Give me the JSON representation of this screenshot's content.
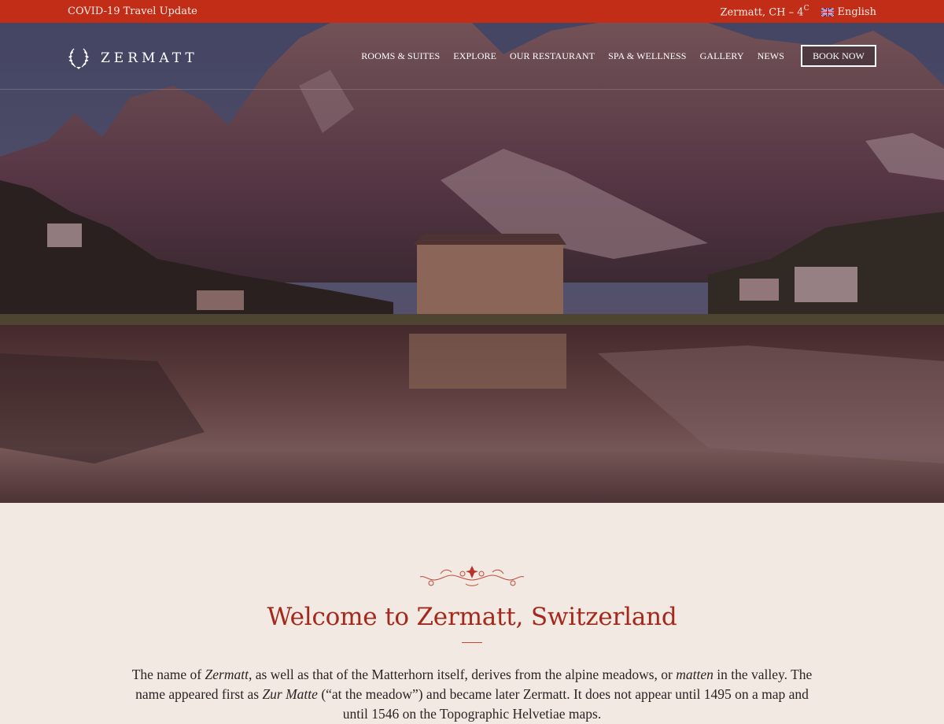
{
  "topbar": {
    "notice_link": "COVID-19 Travel Update",
    "weather": "Zermatt, CH – 4",
    "weather_unit": "C",
    "language": "English",
    "language_flag": "uk-flag-icon"
  },
  "brand": {
    "name": "ZERMATT",
    "logo_icon": "laurel-wreath-icon"
  },
  "nav": {
    "items": [
      {
        "label": "ROOMS & SUITES"
      },
      {
        "label": "EXPLORE"
      },
      {
        "label": "OUR RESTAURANT"
      },
      {
        "label": "SPA & WELLNESS"
      },
      {
        "label": "GALLERY"
      },
      {
        "label": "NEWS"
      }
    ],
    "cta": "BOOK NOW"
  },
  "hero": {
    "image": "alpine lake with hotel and mountain reflections"
  },
  "intro": {
    "ornament_icon": "flourish-ornament-icon",
    "title": "Welcome to Zermatt, Switzerland",
    "paragraph": [
      {
        "text": "The name of ",
        "italic": false
      },
      {
        "text": "Zermatt",
        "italic": true
      },
      {
        "text": ", as well as that of the Matterhorn itself, derives from the alpine meadows, or ",
        "italic": false
      },
      {
        "text": "matten",
        "italic": true
      },
      {
        "text": " in the valley. The name appeared first as ",
        "italic": false
      },
      {
        "text": "Zur Matte",
        "italic": true
      },
      {
        "text": " (“at the meadow”) and became later Zermatt. It does not appear until 1495 on a map and until 1546 on the Topographic Helvetiae maps.",
        "italic": false
      }
    ]
  },
  "colors": {
    "brand_red": "#c22d18",
    "heading_red": "#a4281b",
    "page_bg": "#f1e9e2"
  }
}
